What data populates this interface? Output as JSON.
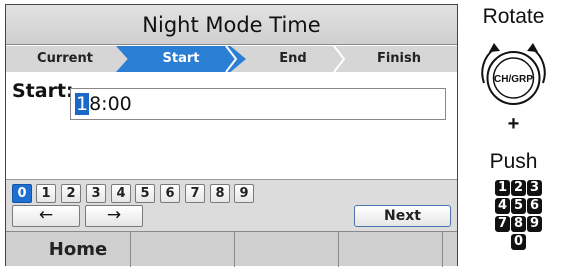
{
  "screen": {
    "title": "Night Mode Time",
    "steps": [
      "Current",
      "Start",
      "End",
      "Finish"
    ],
    "start_label": "Start:",
    "start_value_cursor": "1",
    "start_value_rest": "8:00"
  },
  "keypad": {
    "digits": [
      "0",
      "1",
      "2",
      "3",
      "4",
      "5",
      "6",
      "7",
      "8",
      "9"
    ],
    "left_arrow": "←",
    "right_arrow": "→",
    "next_label": "Next"
  },
  "softkeys": [
    "Home",
    "",
    "",
    "",
    ""
  ],
  "instructions": {
    "rotate_label": "Rotate",
    "knob_label": "CH/GRP",
    "plus": "+",
    "push_label": "Push",
    "number_keys": [
      "1",
      "2",
      "3",
      "4",
      "5",
      "6",
      "7",
      "8",
      "9",
      "0"
    ]
  }
}
